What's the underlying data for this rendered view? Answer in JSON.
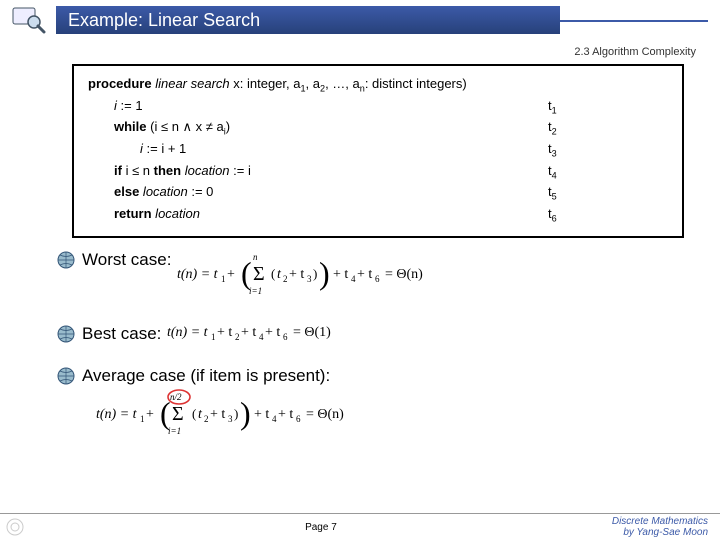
{
  "title": "Example: Linear Search",
  "section": "2.3 Algorithm Complexity",
  "algo": {
    "header_pre": "procedure",
    "header_name": "linear search",
    "header_post": " x: integer, a",
    "header_post2": ", a",
    "header_post3": ", …, a",
    "header_post4": ": distinct integers)",
    "l1_left_pre": "i",
    "l1_left_post": " := 1",
    "l1_right": "t",
    "l2_kw": "while",
    "l2_left": " (i ≤ n ∧ x ≠ a",
    "l2_left2": ")",
    "l2_right": "t",
    "l3_left_pre": "i",
    "l3_left_post": " := i + 1",
    "l3_right": "t",
    "l4_kw1": "if",
    "l4_mid": " i ≤ n ",
    "l4_kw2": "then",
    "l4_post_pre": " location",
    "l4_post": " := i",
    "l4_right": "t",
    "l5_kw": "else",
    "l5_post_pre": " location",
    "l5_post": " := 0",
    "l5_right": "t",
    "l6_kw": "return",
    "l6_post": " location",
    "l6_right": "t"
  },
  "bullets": {
    "worst": "Worst case:",
    "best": "Best case:",
    "avg": "Average case (if item is present):"
  },
  "footer": {
    "page": "Page 7",
    "credit_line1": "Discrete Mathematics",
    "credit_line2": "by Yang-Sae Moon"
  },
  "chart_data": null
}
